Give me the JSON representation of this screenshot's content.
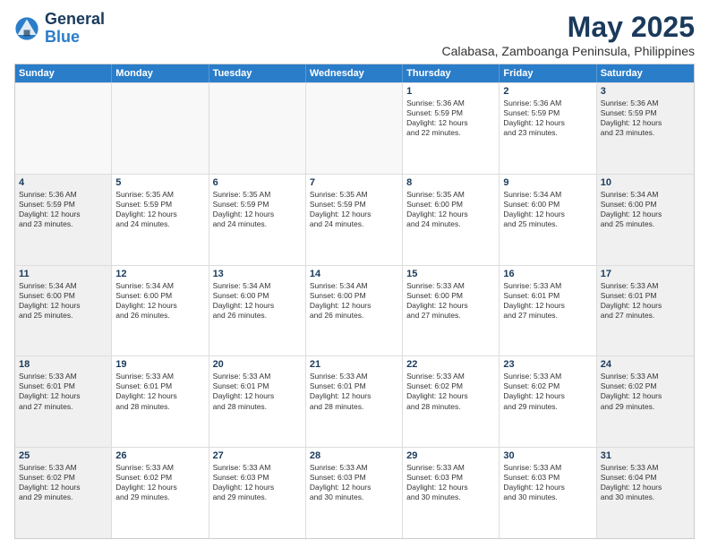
{
  "logo": {
    "line1": "General",
    "line2": "Blue"
  },
  "title": "May 2025",
  "subtitle": "Calabasa, Zamboanga Peninsula, Philippines",
  "days": [
    "Sunday",
    "Monday",
    "Tuesday",
    "Wednesday",
    "Thursday",
    "Friday",
    "Saturday"
  ],
  "weeks": [
    [
      {
        "day": "",
        "content": ""
      },
      {
        "day": "",
        "content": ""
      },
      {
        "day": "",
        "content": ""
      },
      {
        "day": "",
        "content": ""
      },
      {
        "day": "1",
        "content": "Sunrise: 5:36 AM\nSunset: 5:59 PM\nDaylight: 12 hours\nand 22 minutes."
      },
      {
        "day": "2",
        "content": "Sunrise: 5:36 AM\nSunset: 5:59 PM\nDaylight: 12 hours\nand 23 minutes."
      },
      {
        "day": "3",
        "content": "Sunrise: 5:36 AM\nSunset: 5:59 PM\nDaylight: 12 hours\nand 23 minutes."
      }
    ],
    [
      {
        "day": "4",
        "content": "Sunrise: 5:36 AM\nSunset: 5:59 PM\nDaylight: 12 hours\nand 23 minutes."
      },
      {
        "day": "5",
        "content": "Sunrise: 5:35 AM\nSunset: 5:59 PM\nDaylight: 12 hours\nand 24 minutes."
      },
      {
        "day": "6",
        "content": "Sunrise: 5:35 AM\nSunset: 5:59 PM\nDaylight: 12 hours\nand 24 minutes."
      },
      {
        "day": "7",
        "content": "Sunrise: 5:35 AM\nSunset: 5:59 PM\nDaylight: 12 hours\nand 24 minutes."
      },
      {
        "day": "8",
        "content": "Sunrise: 5:35 AM\nSunset: 6:00 PM\nDaylight: 12 hours\nand 24 minutes."
      },
      {
        "day": "9",
        "content": "Sunrise: 5:34 AM\nSunset: 6:00 PM\nDaylight: 12 hours\nand 25 minutes."
      },
      {
        "day": "10",
        "content": "Sunrise: 5:34 AM\nSunset: 6:00 PM\nDaylight: 12 hours\nand 25 minutes."
      }
    ],
    [
      {
        "day": "11",
        "content": "Sunrise: 5:34 AM\nSunset: 6:00 PM\nDaylight: 12 hours\nand 25 minutes."
      },
      {
        "day": "12",
        "content": "Sunrise: 5:34 AM\nSunset: 6:00 PM\nDaylight: 12 hours\nand 26 minutes."
      },
      {
        "day": "13",
        "content": "Sunrise: 5:34 AM\nSunset: 6:00 PM\nDaylight: 12 hours\nand 26 minutes."
      },
      {
        "day": "14",
        "content": "Sunrise: 5:34 AM\nSunset: 6:00 PM\nDaylight: 12 hours\nand 26 minutes."
      },
      {
        "day": "15",
        "content": "Sunrise: 5:33 AM\nSunset: 6:00 PM\nDaylight: 12 hours\nand 27 minutes."
      },
      {
        "day": "16",
        "content": "Sunrise: 5:33 AM\nSunset: 6:01 PM\nDaylight: 12 hours\nand 27 minutes."
      },
      {
        "day": "17",
        "content": "Sunrise: 5:33 AM\nSunset: 6:01 PM\nDaylight: 12 hours\nand 27 minutes."
      }
    ],
    [
      {
        "day": "18",
        "content": "Sunrise: 5:33 AM\nSunset: 6:01 PM\nDaylight: 12 hours\nand 27 minutes."
      },
      {
        "day": "19",
        "content": "Sunrise: 5:33 AM\nSunset: 6:01 PM\nDaylight: 12 hours\nand 28 minutes."
      },
      {
        "day": "20",
        "content": "Sunrise: 5:33 AM\nSunset: 6:01 PM\nDaylight: 12 hours\nand 28 minutes."
      },
      {
        "day": "21",
        "content": "Sunrise: 5:33 AM\nSunset: 6:01 PM\nDaylight: 12 hours\nand 28 minutes."
      },
      {
        "day": "22",
        "content": "Sunrise: 5:33 AM\nSunset: 6:02 PM\nDaylight: 12 hours\nand 28 minutes."
      },
      {
        "day": "23",
        "content": "Sunrise: 5:33 AM\nSunset: 6:02 PM\nDaylight: 12 hours\nand 29 minutes."
      },
      {
        "day": "24",
        "content": "Sunrise: 5:33 AM\nSunset: 6:02 PM\nDaylight: 12 hours\nand 29 minutes."
      }
    ],
    [
      {
        "day": "25",
        "content": "Sunrise: 5:33 AM\nSunset: 6:02 PM\nDaylight: 12 hours\nand 29 minutes."
      },
      {
        "day": "26",
        "content": "Sunrise: 5:33 AM\nSunset: 6:02 PM\nDaylight: 12 hours\nand 29 minutes."
      },
      {
        "day": "27",
        "content": "Sunrise: 5:33 AM\nSunset: 6:03 PM\nDaylight: 12 hours\nand 29 minutes."
      },
      {
        "day": "28",
        "content": "Sunrise: 5:33 AM\nSunset: 6:03 PM\nDaylight: 12 hours\nand 30 minutes."
      },
      {
        "day": "29",
        "content": "Sunrise: 5:33 AM\nSunset: 6:03 PM\nDaylight: 12 hours\nand 30 minutes."
      },
      {
        "day": "30",
        "content": "Sunrise: 5:33 AM\nSunset: 6:03 PM\nDaylight: 12 hours\nand 30 minutes."
      },
      {
        "day": "31",
        "content": "Sunrise: 5:33 AM\nSunset: 6:04 PM\nDaylight: 12 hours\nand 30 minutes."
      }
    ]
  ]
}
